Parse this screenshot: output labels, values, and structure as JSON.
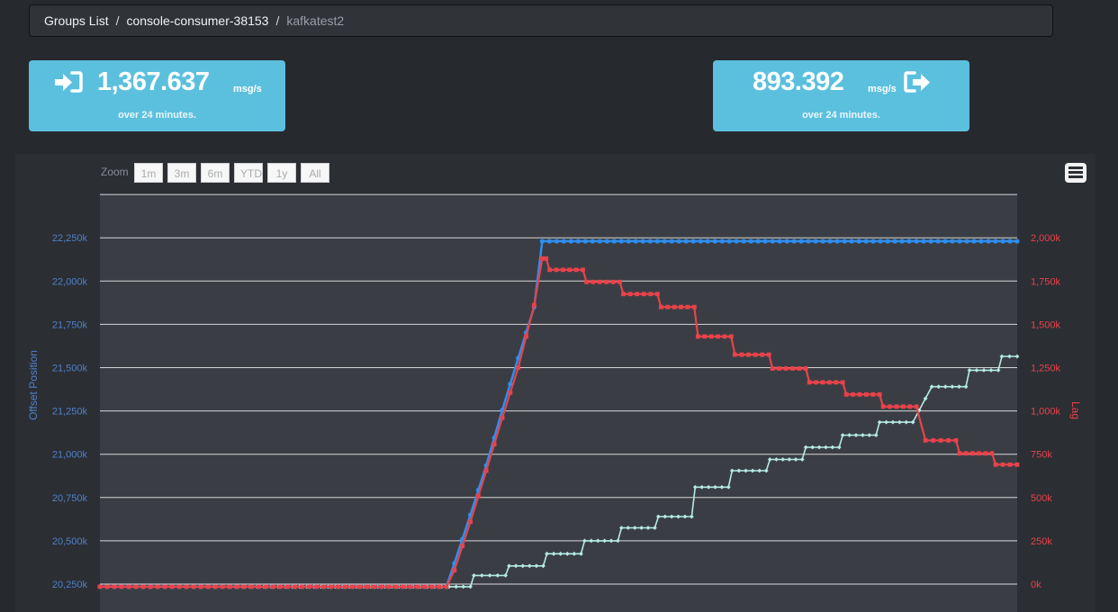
{
  "breadcrumb": {
    "items": [
      "Groups List",
      "console-consumer-38153"
    ],
    "current": "kafkatest2",
    "separator": "/"
  },
  "stats": {
    "consumed": {
      "value": "1,367.637",
      "unit": "msg/s",
      "subtitle": "over 24 minutes.",
      "icon": "sign-in-icon"
    },
    "produced": {
      "value": "893.392",
      "unit": "msg/s",
      "subtitle": "over 24 minutes.",
      "icon": "sign-out-icon"
    }
  },
  "zoom": {
    "label": "Zoom",
    "buttons": [
      "1m",
      "3m",
      "6m",
      "YTD",
      "1y",
      "All"
    ]
  },
  "colors": {
    "background": "#26292e",
    "panel": "#2b2e33",
    "plot": "#3a3e44",
    "stat_box": "#5bc0de",
    "offset_series": "#2f8ef0",
    "lag_series": "#e8424b",
    "teal_series": "#b5eae4",
    "left_axis": "#4f81c7",
    "right_axis": "#e8424b"
  },
  "chart_data": {
    "type": "line",
    "y_axis_left": {
      "label": "Offset Position",
      "ticks": [
        "20,250k",
        "20,500k",
        "20,750k",
        "21,000k",
        "21,250k",
        "21,500k",
        "21,750k",
        "22,000k",
        "22,250k"
      ],
      "range": [
        20250,
        22500
      ],
      "unit": "k"
    },
    "y_axis_right": {
      "label": "Lag",
      "ticks": [
        "0k",
        "250k",
        "500k",
        "750k",
        "1,000k",
        "1,250k",
        "1,500k",
        "1,750k",
        "2,000k"
      ],
      "range": [
        0,
        2250
      ],
      "unit": "k"
    },
    "x_range": [
      0,
      1
    ],
    "grid": true,
    "series": [
      {
        "key": "offset",
        "axis": "left",
        "marker": "circle",
        "points": [
          [
            0,
            20235
          ],
          [
            0.3777,
            20235
          ],
          [
            0.3865,
            20370
          ],
          [
            0.4039,
            20650
          ],
          [
            0.4212,
            20935
          ],
          [
            0.4387,
            21255
          ],
          [
            0.456,
            21555
          ],
          [
            0.4734,
            21850
          ],
          [
            0.4822,
            22230
          ],
          [
            1,
            22230
          ]
        ]
      },
      {
        "key": "lag",
        "axis": "right",
        "marker": "square",
        "points": [
          [
            0,
            -15
          ],
          [
            0.3777,
            -15
          ],
          [
            0.3865,
            80
          ],
          [
            0.4039,
            360
          ],
          [
            0.4212,
            655
          ],
          [
            0.4387,
            960
          ],
          [
            0.456,
            1250
          ],
          [
            0.4734,
            1610
          ],
          [
            0.4822,
            1880
          ],
          [
            0.4865,
            1880
          ],
          [
            0.4903,
            1815
          ],
          [
            0.5265,
            1815
          ],
          [
            0.5305,
            1745
          ],
          [
            0.5667,
            1745
          ],
          [
            0.5707,
            1675
          ],
          [
            0.6078,
            1675
          ],
          [
            0.6118,
            1600
          ],
          [
            0.648,
            1600
          ],
          [
            0.652,
            1430
          ],
          [
            0.6882,
            1430
          ],
          [
            0.6922,
            1325
          ],
          [
            0.7294,
            1325
          ],
          [
            0.7333,
            1245
          ],
          [
            0.7696,
            1245
          ],
          [
            0.7735,
            1165
          ],
          [
            0.8098,
            1165
          ],
          [
            0.8137,
            1095
          ],
          [
            0.85,
            1095
          ],
          [
            0.8539,
            1025
          ],
          [
            0.8902,
            1025
          ],
          [
            0.9,
            830
          ],
          [
            0.9333,
            830
          ],
          [
            0.9373,
            755
          ],
          [
            0.9725,
            755
          ],
          [
            0.9765,
            690
          ],
          [
            1,
            690
          ]
        ]
      },
      {
        "key": "consumed",
        "axis": "right",
        "marker": "diamond",
        "points": [
          [
            0,
            -15
          ],
          [
            0.4039,
            -15
          ],
          [
            0.4078,
            50
          ],
          [
            0.4422,
            50
          ],
          [
            0.4461,
            105
          ],
          [
            0.4833,
            105
          ],
          [
            0.4873,
            175
          ],
          [
            0.5245,
            175
          ],
          [
            0.5284,
            250
          ],
          [
            0.5647,
            250
          ],
          [
            0.5686,
            325
          ],
          [
            0.6049,
            325
          ],
          [
            0.6088,
            390
          ],
          [
            0.6451,
            390
          ],
          [
            0.649,
            560
          ],
          [
            0.6853,
            560
          ],
          [
            0.6892,
            655
          ],
          [
            0.7265,
            655
          ],
          [
            0.7304,
            720
          ],
          [
            0.7657,
            720
          ],
          [
            0.7696,
            790
          ],
          [
            0.8059,
            790
          ],
          [
            0.8098,
            860
          ],
          [
            0.8461,
            860
          ],
          [
            0.85,
            935
          ],
          [
            0.8863,
            935
          ],
          [
            0.9069,
            1140
          ],
          [
            0.9441,
            1140
          ],
          [
            0.948,
            1235
          ],
          [
            0.9794,
            1235
          ],
          [
            0.9833,
            1315
          ],
          [
            1,
            1315
          ]
        ]
      }
    ]
  }
}
